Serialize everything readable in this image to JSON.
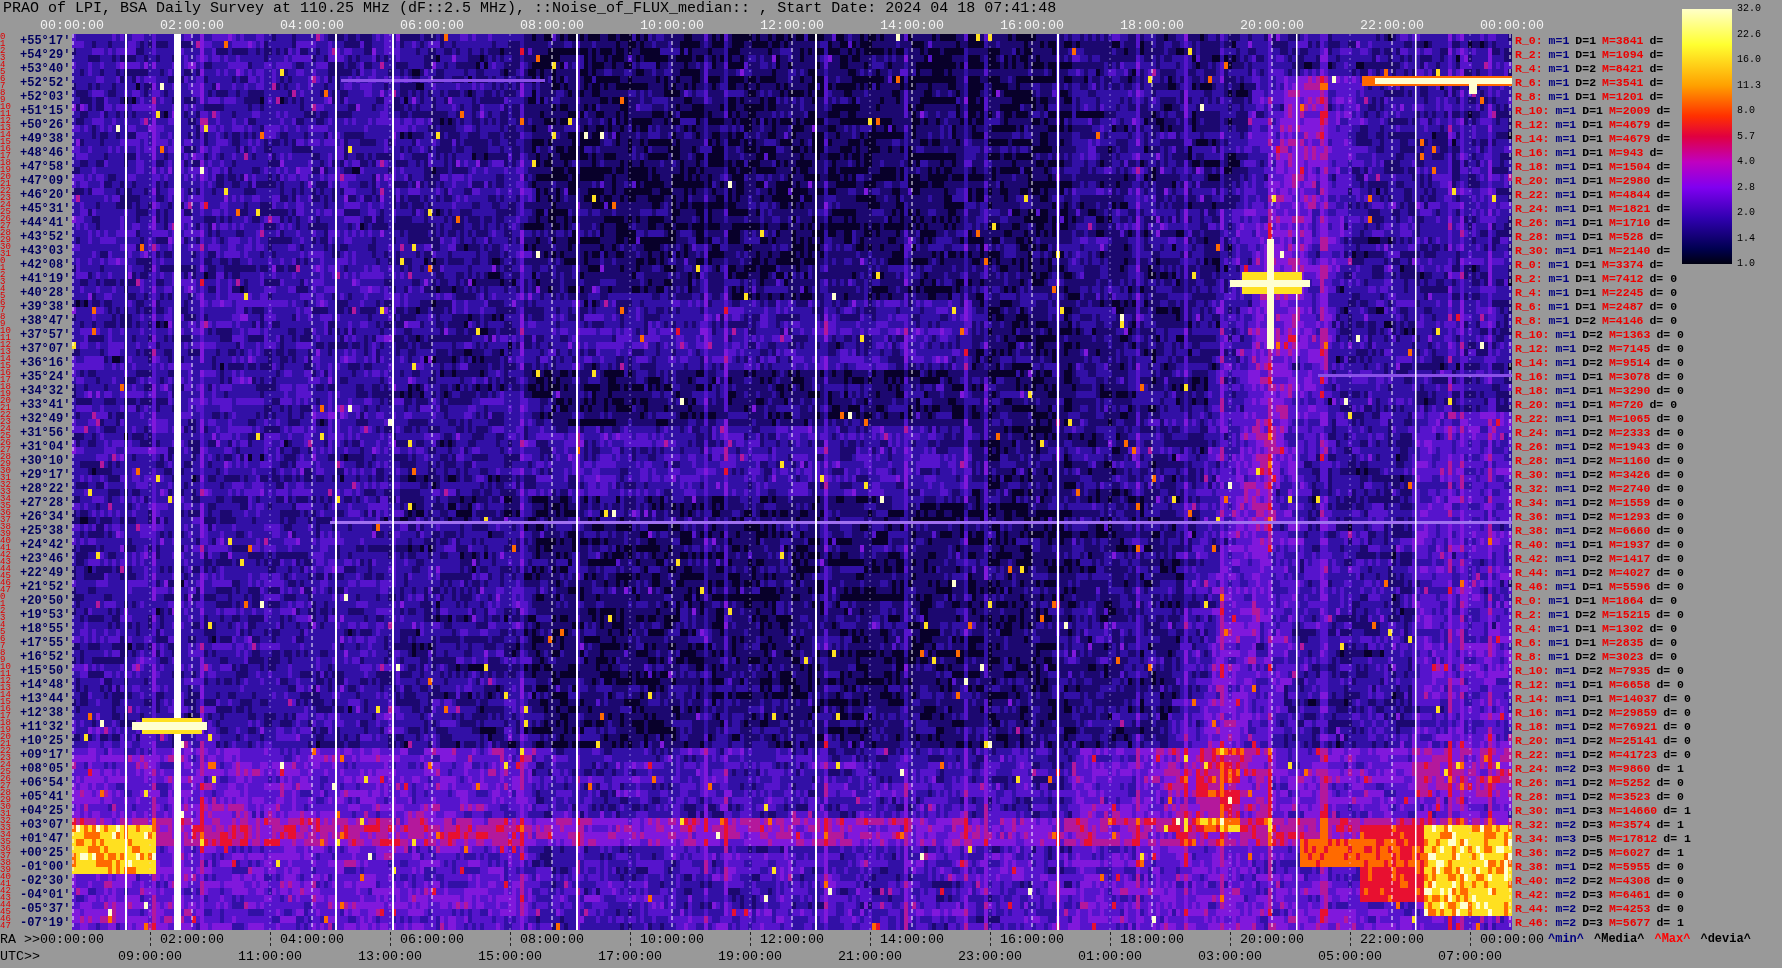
{
  "title": "PRAO of LPI, BSA Daily Survey at 110.25 MHz (dF::2.5 MHz), ::Noise_of_FLUX_median:: , Start Date: 2024 04 18 07:41:48",
  "top_axis": {
    "ticks": [
      "00:00:00",
      "02:00:00",
      "04:00:00",
      "06:00:00",
      "08:00:00",
      "10:00:00",
      "12:00:00",
      "14:00:00",
      "16:00:00",
      "18:00:00",
      "20:00:00",
      "22:00:00",
      "00:00:00"
    ]
  },
  "declination_axis": {
    "rows": [
      {
        "indices": [
          "0",
          "1"
        ],
        "label": "+55°17'"
      },
      {
        "indices": [
          "2",
          "3"
        ],
        "label": "+54°29'"
      },
      {
        "indices": [
          "4",
          "5"
        ],
        "label": "+53°40'"
      },
      {
        "indices": [
          "6",
          "7"
        ],
        "label": "+52°52'"
      },
      {
        "indices": [
          "8",
          "9"
        ],
        "label": "+52°03'"
      },
      {
        "indices": [
          "10",
          "11"
        ],
        "label": "+51°15'"
      },
      {
        "indices": [
          "12",
          "13"
        ],
        "label": "+50°26'"
      },
      {
        "indices": [
          "14",
          "15"
        ],
        "label": "+49°38'"
      },
      {
        "indices": [
          "16",
          "17"
        ],
        "label": "+48°46'"
      },
      {
        "indices": [
          "18",
          "19"
        ],
        "label": "+47°58'"
      },
      {
        "indices": [
          "20",
          "21"
        ],
        "label": "+47°09'"
      },
      {
        "indices": [
          "22",
          "23"
        ],
        "label": "+46°20'"
      },
      {
        "indices": [
          "24",
          "25"
        ],
        "label": "+45°31'"
      },
      {
        "indices": [
          "26",
          "27"
        ],
        "label": "+44°41'"
      },
      {
        "indices": [
          "28",
          "29"
        ],
        "label": "+43°52'"
      },
      {
        "indices": [
          "30",
          "31"
        ],
        "label": "+43°03'"
      },
      {
        "indices": [
          "0",
          "1"
        ],
        "label": "+42°08'"
      },
      {
        "indices": [
          "2",
          "3"
        ],
        "label": "+41°19'"
      },
      {
        "indices": [
          "4",
          "5"
        ],
        "label": "+40°28'"
      },
      {
        "indices": [
          "6",
          "7"
        ],
        "label": "+39°38'"
      },
      {
        "indices": [
          "8",
          "9"
        ],
        "label": "+38°47'"
      },
      {
        "indices": [
          "10",
          "11"
        ],
        "label": "+37°57'"
      },
      {
        "indices": [
          "12",
          "13"
        ],
        "label": "+37°07'"
      },
      {
        "indices": [
          "14",
          "15"
        ],
        "label": "+36°16'"
      },
      {
        "indices": [
          "16",
          "17"
        ],
        "label": "+35°24'"
      },
      {
        "indices": [
          "18",
          "19"
        ],
        "label": "+34°32'"
      },
      {
        "indices": [
          "20",
          "21"
        ],
        "label": "+33°41'"
      },
      {
        "indices": [
          "22",
          "23"
        ],
        "label": "+32°49'"
      },
      {
        "indices": [
          "24",
          "25"
        ],
        "label": "+31°56'"
      },
      {
        "indices": [
          "26",
          "27"
        ],
        "label": "+31°04'"
      },
      {
        "indices": [
          "28",
          "29"
        ],
        "label": "+30°10'"
      },
      {
        "indices": [
          "30",
          "31"
        ],
        "label": "+29°17'"
      },
      {
        "indices": [
          "32",
          "33"
        ],
        "label": "+28°22'"
      },
      {
        "indices": [
          "34",
          "35"
        ],
        "label": "+27°28'"
      },
      {
        "indices": [
          "36",
          "37"
        ],
        "label": "+26°34'"
      },
      {
        "indices": [
          "38",
          "39"
        ],
        "label": "+25°38'"
      },
      {
        "indices": [
          "40",
          "41"
        ],
        "label": "+24°42'"
      },
      {
        "indices": [
          "42",
          "43"
        ],
        "label": "+23°46'"
      },
      {
        "indices": [
          "44",
          "45"
        ],
        "label": "+22°49'"
      },
      {
        "indices": [
          "46",
          "47"
        ],
        "label": "+21°52'"
      },
      {
        "indices": [
          "0",
          "1"
        ],
        "label": "+20°50'"
      },
      {
        "indices": [
          "2",
          "3"
        ],
        "label": "+19°53'"
      },
      {
        "indices": [
          "4",
          "5"
        ],
        "label": "+18°55'"
      },
      {
        "indices": [
          "6",
          "7"
        ],
        "label": "+17°55'"
      },
      {
        "indices": [
          "8",
          "9"
        ],
        "label": "+16°52'"
      },
      {
        "indices": [
          "10",
          "11"
        ],
        "label": "+15°50'"
      },
      {
        "indices": [
          "12",
          "13"
        ],
        "label": "+14°48'"
      },
      {
        "indices": [
          "14",
          "15"
        ],
        "label": "+13°44'"
      },
      {
        "indices": [
          "16",
          "17"
        ],
        "label": "+12°38'"
      },
      {
        "indices": [
          "18",
          "19"
        ],
        "label": "+11°32'"
      },
      {
        "indices": [
          "20",
          "21"
        ],
        "label": "+10°25'"
      },
      {
        "indices": [
          "22",
          "23"
        ],
        "label": "+09°17'"
      },
      {
        "indices": [
          "24",
          "25"
        ],
        "label": "+08°05'"
      },
      {
        "indices": [
          "26",
          "27"
        ],
        "label": "+06°54'"
      },
      {
        "indices": [
          "28",
          "29"
        ],
        "label": "+05°41'"
      },
      {
        "indices": [
          "30",
          "31"
        ],
        "label": "+04°25'"
      },
      {
        "indices": [
          "32",
          "33"
        ],
        "label": "+03°07'"
      },
      {
        "indices": [
          "34",
          "35"
        ],
        "label": "+01°47'"
      },
      {
        "indices": [
          "36",
          "37"
        ],
        "label": "+00°25'"
      },
      {
        "indices": [
          "38",
          "39"
        ],
        "label": "-01°00'"
      },
      {
        "indices": [
          "40",
          "41"
        ],
        "label": "-02°30'"
      },
      {
        "indices": [
          "42",
          "43"
        ],
        "label": "-04°01'"
      },
      {
        "indices": [
          "44",
          "45"
        ],
        "label": "-05°37'"
      },
      {
        "indices": [
          "46",
          "47"
        ],
        "label": "-07°19'"
      }
    ]
  },
  "row_stats": [
    {
      "row": "R_0:",
      "min": "m=1",
      "median": "D=1",
      "max": "M=3841",
      "deviation": "d="
    },
    {
      "row": "R_2:",
      "min": "m=1",
      "median": "D=1",
      "max": "M=1094",
      "deviation": "d="
    },
    {
      "row": "R_4:",
      "min": "m=1",
      "median": "D=2",
      "max": "M=8421",
      "deviation": "d="
    },
    {
      "row": "R_6:",
      "min": "m=1",
      "median": "D=2",
      "max": "M=3541",
      "deviation": "d="
    },
    {
      "row": "R_8:",
      "min": "m=1",
      "median": "D=1",
      "max": "M=1201",
      "deviation": "d="
    },
    {
      "row": "R_10:",
      "min": "m=1",
      "median": "D=1",
      "max": "M=2009",
      "deviation": "d="
    },
    {
      "row": "R_12:",
      "min": "m=1",
      "median": "D=1",
      "max": "M=4679",
      "deviation": "d="
    },
    {
      "row": "R_14:",
      "min": "m=1",
      "median": "D=1",
      "max": "M=4679",
      "deviation": "d="
    },
    {
      "row": "R_16:",
      "min": "m=1",
      "median": "D=1",
      "max": "M=943",
      "deviation": "d="
    },
    {
      "row": "R_18:",
      "min": "m=1",
      "median": "D=1",
      "max": "M=1504",
      "deviation": "d="
    },
    {
      "row": "R_20:",
      "min": "m=1",
      "median": "D=1",
      "max": "M=2980",
      "deviation": "d="
    },
    {
      "row": "R_22:",
      "min": "m=1",
      "median": "D=1",
      "max": "M=4844",
      "deviation": "d="
    },
    {
      "row": "R_24:",
      "min": "m=1",
      "median": "D=1",
      "max": "M=1821",
      "deviation": "d="
    },
    {
      "row": "R_26:",
      "min": "m=1",
      "median": "D=1",
      "max": "M=1710",
      "deviation": "d="
    },
    {
      "row": "R_28:",
      "min": "m=1",
      "median": "D=1",
      "max": "M=528",
      "deviation": "d="
    },
    {
      "row": "R_30:",
      "min": "m=1",
      "median": "D=1",
      "max": "M=2140",
      "deviation": "d="
    },
    {
      "row": "R_0:",
      "min": "m=1",
      "median": "D=1",
      "max": "M=3374",
      "deviation": "d="
    },
    {
      "row": "R_2:",
      "min": "m=1",
      "median": "D=1",
      "max": "M=7412",
      "deviation": "d= 0"
    },
    {
      "row": "R_4:",
      "min": "m=1",
      "median": "D=1",
      "max": "M=2245",
      "deviation": "d= 0"
    },
    {
      "row": "R_6:",
      "min": "m=1",
      "median": "D=1",
      "max": "M=2487",
      "deviation": "d= 0"
    },
    {
      "row": "R_8:",
      "min": "m=1",
      "median": "D=2",
      "max": "M=4146",
      "deviation": "d= 0"
    },
    {
      "row": "R_10:",
      "min": "m=1",
      "median": "D=2",
      "max": "M=1363",
      "deviation": "d= 0"
    },
    {
      "row": "R_12:",
      "min": "m=1",
      "median": "D=2",
      "max": "M=7145",
      "deviation": "d= 0"
    },
    {
      "row": "R_14:",
      "min": "m=1",
      "median": "D=2",
      "max": "M=9514",
      "deviation": "d= 0"
    },
    {
      "row": "R_16:",
      "min": "m=1",
      "median": "D=1",
      "max": "M=3078",
      "deviation": "d= 0"
    },
    {
      "row": "R_18:",
      "min": "m=1",
      "median": "D=1",
      "max": "M=3290",
      "deviation": "d= 0"
    },
    {
      "row": "R_20:",
      "min": "m=1",
      "median": "D=1",
      "max": "M=720",
      "deviation": "d= 0"
    },
    {
      "row": "R_22:",
      "min": "m=1",
      "median": "D=1",
      "max": "M=1065",
      "deviation": "d= 0"
    },
    {
      "row": "R_24:",
      "min": "m=1",
      "median": "D=2",
      "max": "M=2333",
      "deviation": "d= 0"
    },
    {
      "row": "R_26:",
      "min": "m=1",
      "median": "D=2",
      "max": "M=1943",
      "deviation": "d= 0"
    },
    {
      "row": "R_28:",
      "min": "m=1",
      "median": "D=2",
      "max": "M=1160",
      "deviation": "d= 0"
    },
    {
      "row": "R_30:",
      "min": "m=1",
      "median": "D=2",
      "max": "M=3426",
      "deviation": "d= 0"
    },
    {
      "row": "R_32:",
      "min": "m=1",
      "median": "D=2",
      "max": "M=2740",
      "deviation": "d= 0"
    },
    {
      "row": "R_34:",
      "min": "m=1",
      "median": "D=2",
      "max": "M=1559",
      "deviation": "d= 0"
    },
    {
      "row": "R_36:",
      "min": "m=1",
      "median": "D=2",
      "max": "M=1293",
      "deviation": "d= 0"
    },
    {
      "row": "R_38:",
      "min": "m=1",
      "median": "D=2",
      "max": "M=6660",
      "deviation": "d= 0"
    },
    {
      "row": "R_40:",
      "min": "m=1",
      "median": "D=1",
      "max": "M=1937",
      "deviation": "d= 0"
    },
    {
      "row": "R_42:",
      "min": "m=1",
      "median": "D=2",
      "max": "M=1417",
      "deviation": "d= 0"
    },
    {
      "row": "R_44:",
      "min": "m=1",
      "median": "D=2",
      "max": "M=4027",
      "deviation": "d= 0"
    },
    {
      "row": "R_46:",
      "min": "m=1",
      "median": "D=1",
      "max": "M=5596",
      "deviation": "d= 0"
    },
    {
      "row": "R_0:",
      "min": "m=1",
      "median": "D=1",
      "max": "M=1864",
      "deviation": "d= 0"
    },
    {
      "row": "R_2:",
      "min": "m=1",
      "median": "D=2",
      "max": "M=15215",
      "deviation": "d= 0"
    },
    {
      "row": "R_4:",
      "min": "m=1",
      "median": "D=1",
      "max": "M=1302",
      "deviation": "d= 0"
    },
    {
      "row": "R_6:",
      "min": "m=1",
      "median": "D=1",
      "max": "M=2835",
      "deviation": "d= 0"
    },
    {
      "row": "R_8:",
      "min": "m=1",
      "median": "D=2",
      "max": "M=3023",
      "deviation": "d= 0"
    },
    {
      "row": "R_10:",
      "min": "m=1",
      "median": "D=2",
      "max": "M=7935",
      "deviation": "d= 0"
    },
    {
      "row": "R_12:",
      "min": "m=1",
      "median": "D=1",
      "max": "M=6658",
      "deviation": "d= 0"
    },
    {
      "row": "R_14:",
      "min": "m=1",
      "median": "D=1",
      "max": "M=14037",
      "deviation": "d= 0"
    },
    {
      "row": "R_16:",
      "min": "m=1",
      "median": "D=2",
      "max": "M=29859",
      "deviation": "d= 0"
    },
    {
      "row": "R_18:",
      "min": "m=1",
      "median": "D=2",
      "max": "M=76921",
      "deviation": "d= 0"
    },
    {
      "row": "R_20:",
      "min": "m=1",
      "median": "D=2",
      "max": "M=25141",
      "deviation": "d= 0"
    },
    {
      "row": "R_22:",
      "min": "m=1",
      "median": "D=2",
      "max": "M=41723",
      "deviation": "d= 0"
    },
    {
      "row": "R_24:",
      "min": "m=2",
      "median": "D=3",
      "max": "M=9860",
      "deviation": "d= 1"
    },
    {
      "row": "R_26:",
      "min": "m=1",
      "median": "D=2",
      "max": "M=5252",
      "deviation": "d= 0"
    },
    {
      "row": "R_28:",
      "min": "m=1",
      "median": "D=2",
      "max": "M=3523",
      "deviation": "d= 0"
    },
    {
      "row": "R_30:",
      "min": "m=1",
      "median": "D=3",
      "max": "M=14660",
      "deviation": "d= 1"
    },
    {
      "row": "R_32:",
      "min": "m=2",
      "median": "D=3",
      "max": "M=3574",
      "deviation": "d= 1"
    },
    {
      "row": "R_34:",
      "min": "m=3",
      "median": "D=5",
      "max": "M=17812",
      "deviation": "d= 1"
    },
    {
      "row": "R_36:",
      "min": "m=2",
      "median": "D=5",
      "max": "M=6027",
      "deviation": "d= 1"
    },
    {
      "row": "R_38:",
      "min": "m=1",
      "median": "D=2",
      "max": "M=5955",
      "deviation": "d= 0"
    },
    {
      "row": "R_40:",
      "min": "m=2",
      "median": "D=2",
      "max": "M=4308",
      "deviation": "d= 0"
    },
    {
      "row": "R_42:",
      "min": "m=2",
      "median": "D=3",
      "max": "M=6461",
      "deviation": "d= 0"
    },
    {
      "row": "R_44:",
      "min": "m=2",
      "median": "D=2",
      "max": "M=4253",
      "deviation": "d= 0"
    },
    {
      "row": "R_46:",
      "min": "m=2",
      "median": "D=3",
      "max": "M=5677",
      "deviation": "d= 1"
    }
  ],
  "colorbar": {
    "ticks": [
      "32.0",
      "22.6",
      "16.0",
      "11.3",
      "8.0",
      "5.7",
      "4.0",
      "2.8",
      "2.0",
      "1.4",
      "1.0"
    ]
  },
  "ra_axis": {
    "prefix": "RA >>",
    "ticks": [
      "00:00:00",
      "02:00:00",
      "04:00:00",
      "06:00:00",
      "08:00:00",
      "10:00:00",
      "12:00:00",
      "14:00:00",
      "16:00:00",
      "18:00:00",
      "20:00:00",
      "22:00:00",
      "00:00:00"
    ]
  },
  "legend": [
    {
      "label": "^min^",
      "color": "#000080"
    },
    {
      "label": "^Media^",
      "color": "#000000"
    },
    {
      "label": "^Max^",
      "color": "#ff0000"
    },
    {
      "label": "^devia^",
      "color": "#000000"
    }
  ],
  "utc_axis": {
    "prefix": "UTC>>",
    "ticks": [
      "09:00:00",
      "11:00:00",
      "13:00:00",
      "15:00:00",
      "17:00:00",
      "19:00:00",
      "21:00:00",
      "23:00:00",
      "01:00:00",
      "03:00:00",
      "05:00:00",
      "07:00:00"
    ]
  }
}
